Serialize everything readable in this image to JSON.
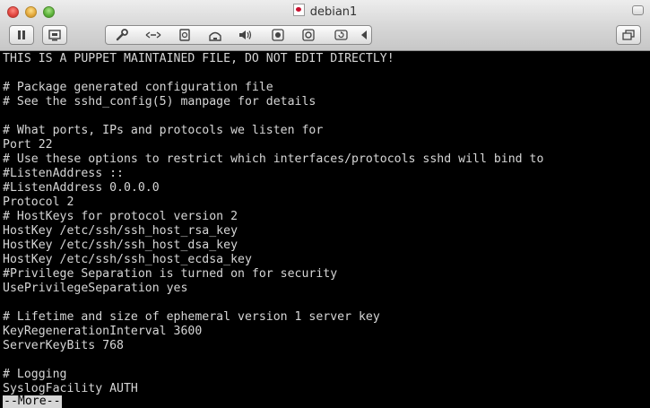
{
  "window": {
    "title": "debian1"
  },
  "toolbar": {
    "pause_icon": "pause-icon",
    "snapshot_icon": "snapshot-icon",
    "settings_icon": "wrench-icon",
    "network_icon": "network-icon",
    "disk_icon": "disk-icon",
    "printer_icon": "printer-icon",
    "sound_icon": "speaker-icon",
    "usb_icon": "usb-icon",
    "cd_icon": "cd-icon",
    "refresh_icon": "refresh-icon",
    "collapse_icon": "chevron-left-icon",
    "fullscreen_icon": "window-icon"
  },
  "terminal": {
    "lines": [
      "THIS IS A PUPPET MAINTAINED FILE, DO NOT EDIT DIRECTLY!",
      "",
      "# Package generated configuration file",
      "# See the sshd_config(5) manpage for details",
      "",
      "# What ports, IPs and protocols we listen for",
      "Port 22",
      "# Use these options to restrict which interfaces/protocols sshd will bind to",
      "#ListenAddress ::",
      "#ListenAddress 0.0.0.0",
      "Protocol 2",
      "# HostKeys for protocol version 2",
      "HostKey /etc/ssh/ssh_host_rsa_key",
      "HostKey /etc/ssh/ssh_host_dsa_key",
      "HostKey /etc/ssh/ssh_host_ecdsa_key",
      "#Privilege Separation is turned on for security",
      "UsePrivilegeSeparation yes",
      "",
      "# Lifetime and size of ephemeral version 1 server key",
      "KeyRegenerationInterval 3600",
      "ServerKeyBits 768",
      "",
      "# Logging",
      "SyslogFacility AUTH"
    ],
    "pager_prompt": "--More--"
  }
}
